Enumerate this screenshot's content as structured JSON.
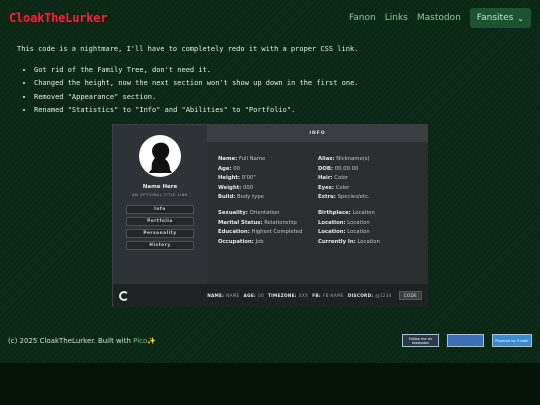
{
  "site": {
    "logo": "CloakTheLurker",
    "nav": [
      "Fanon",
      "Links",
      "Mastodon"
    ],
    "dropdown": "Fansites"
  },
  "intro": {
    "lead": "This code is a nightmare, I'll have to completely redo it with a proper CSS link.",
    "items": [
      "Got rid of the Family Tree, don't need it.",
      "Changed the height, now the next section won't show up down in the first one.",
      "Removed \"Appearance\" section.",
      "Renamed \"Statistics\" to \"Info\" and \"Abilities\" to \"Portfolio\"."
    ]
  },
  "card": {
    "name": "Name Here",
    "subtitle": "AN OPTIONAL TITLE LINK",
    "menu": [
      "Info",
      "Portfolio",
      "Personality",
      "History"
    ],
    "header": "INFO",
    "left_rows": [
      {
        "k": "Name:",
        "v": "Full Name"
      },
      {
        "k": "Age:",
        "v": "00"
      },
      {
        "k": "Height:",
        "v": "0'00\""
      },
      {
        "k": "Weight:",
        "v": "000"
      },
      {
        "k": "Build:",
        "v": "Body type"
      },
      {
        "k": "Sexuality:",
        "v": "Orientation"
      },
      {
        "k": "Marital Status:",
        "v": "Relationship"
      },
      {
        "k": "Education:",
        "v": "Highest Completed"
      },
      {
        "k": "Occupation:",
        "v": "Job"
      }
    ],
    "right_rows": [
      {
        "k": "Alias:",
        "v": "Nickname(s)"
      },
      {
        "k": "DOB:",
        "v": "00.00.00"
      },
      {
        "k": "Hair:",
        "v": "Color"
      },
      {
        "k": "Eyes:",
        "v": "Color"
      },
      {
        "k": "Extra:",
        "v": "Species/etc."
      },
      {
        "k": "Birthplace:",
        "v": "Location"
      },
      {
        "k": "Location:",
        "v": "Location"
      },
      {
        "k": "Location:",
        "v": "Location"
      },
      {
        "k": "Currently In:",
        "v": "Location"
      }
    ],
    "footer": {
      "name_label": "NAME:",
      "name_value": "NAME",
      "age_label": "AGE:",
      "age_value": "00",
      "tz_label": "TIMEZONE:",
      "tz_value": "XXX",
      "fb_label": "FB:",
      "fb_value": "FB NAME",
      "discord_label": "DISCORD:",
      "discord_value": "@1234",
      "code_label": "CODE"
    }
  },
  "footer": {
    "copyright": "(c) 2025 CloakTheLurker. Built with ",
    "pico": "Pico",
    "badges": [
      "Follow me on mastodon",
      "",
      "Powered by Tumblr"
    ]
  },
  "colors": {
    "background": "#082010",
    "accent": "#1d5232",
    "logo": "#e02c3c"
  }
}
